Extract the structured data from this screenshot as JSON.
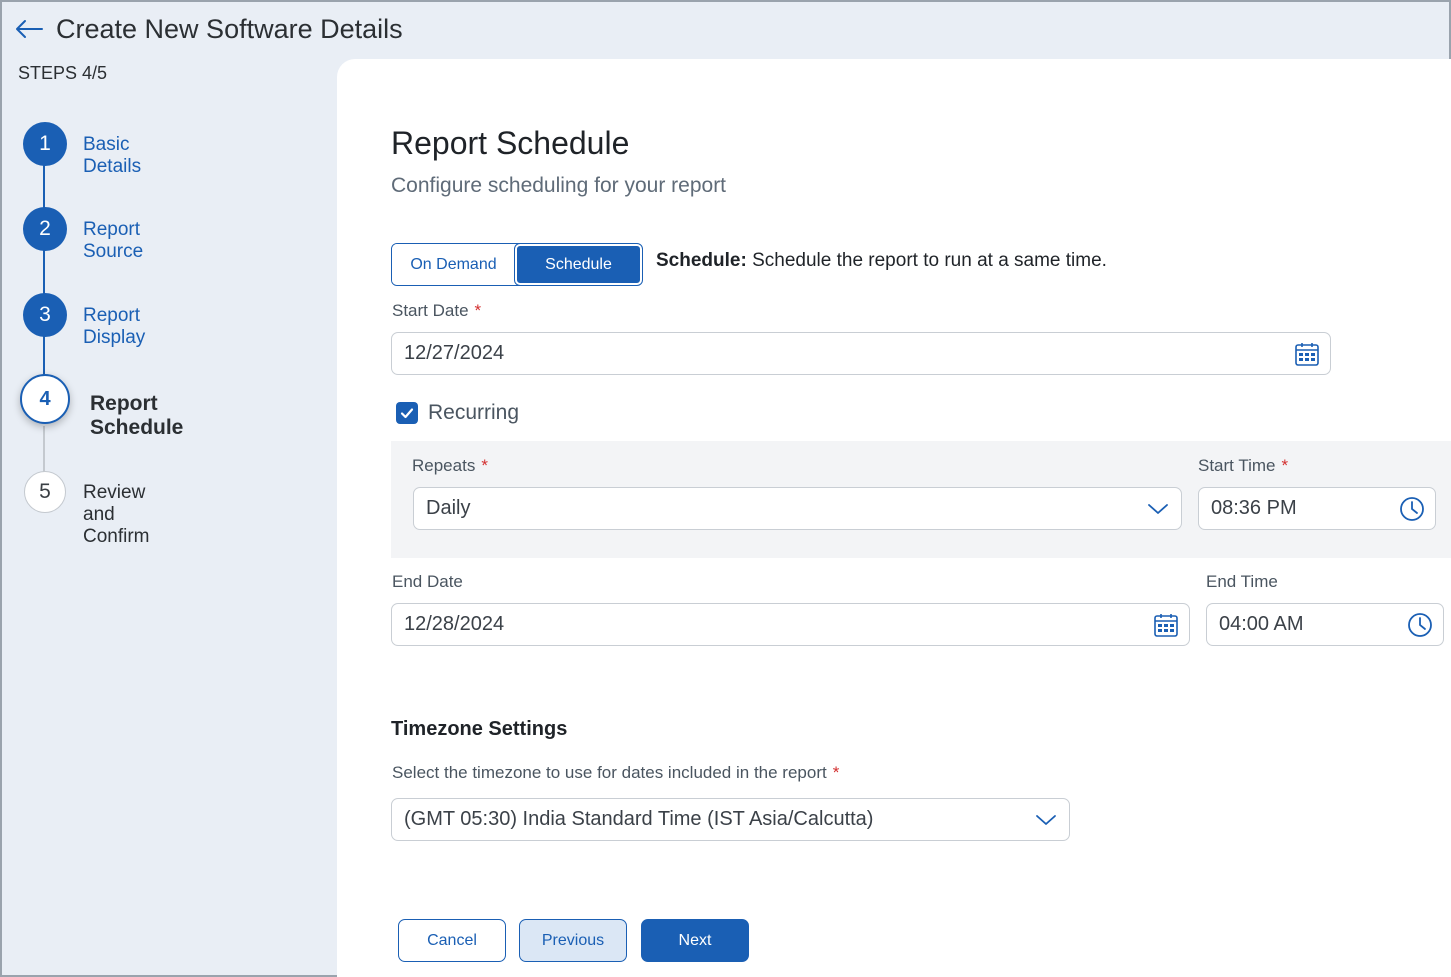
{
  "header": {
    "title": "Create New Software Details"
  },
  "sidebar": {
    "steps_label": "STEPS 4/5",
    "steps": [
      {
        "number": "1",
        "label": "Basic Details",
        "state": "done"
      },
      {
        "number": "2",
        "label": "Report Source",
        "state": "done"
      },
      {
        "number": "3",
        "label": "Report Display",
        "state": "done"
      },
      {
        "number": "4",
        "label": "Report Schedule",
        "state": "current"
      },
      {
        "number": "5",
        "label": "Review and Confirm",
        "state": "future"
      }
    ]
  },
  "main": {
    "title": "Report Schedule",
    "subtitle": "Configure scheduling for your report",
    "toggle": {
      "options": [
        "On Demand",
        "Schedule"
      ],
      "selected": "Schedule",
      "desc_bold": "Schedule:",
      "desc_text": " Schedule the report to run at a same time."
    },
    "start_date": {
      "label": "Start Date",
      "required": "*",
      "value": "12/27/2024"
    },
    "recurring": {
      "label": "Recurring",
      "checked": true
    },
    "repeats": {
      "label": "Repeats",
      "required": "*",
      "value": "Daily"
    },
    "start_time": {
      "label": "Start Time",
      "required": "*",
      "value": "08:36 PM"
    },
    "end_date": {
      "label": "End Date",
      "value": "12/28/2024"
    },
    "end_time": {
      "label": "End Time",
      "value": "04:00 AM"
    },
    "timezone": {
      "title": "Timezone Settings",
      "label": "Select the timezone to use for dates included in the report",
      "required": "*",
      "value": "(GMT 05:30) India Standard Time (IST Asia/Calcutta)"
    }
  },
  "footer": {
    "cancel": "Cancel",
    "previous": "Previous",
    "next": "Next"
  },
  "colors": {
    "accent": "#1a5fb4",
    "required": "#d32f2f"
  }
}
